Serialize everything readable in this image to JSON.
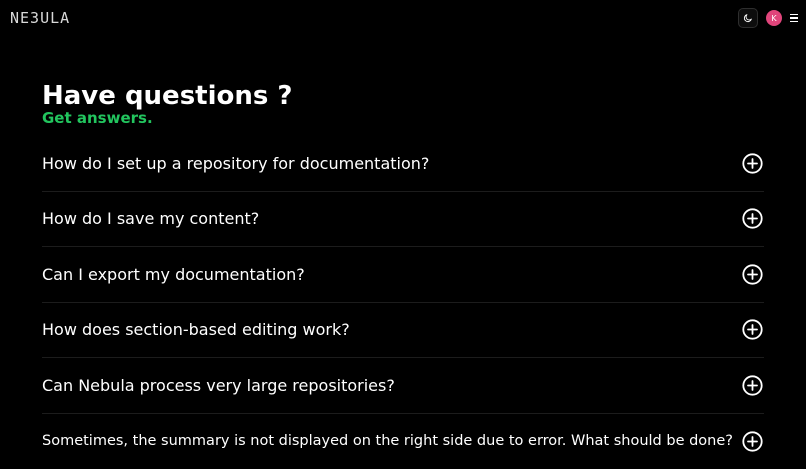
{
  "header": {
    "logo_text": "NE3ULA",
    "theme_icon": "moon-icon",
    "avatar_initial": "K",
    "avatar_color": "#e0457b",
    "menu_icon": "hamburger-menu-icon"
  },
  "faq": {
    "title": "Have questions ?",
    "subtitle": "Get answers.",
    "accent_color": "#22c55e",
    "toggle_icon": "plus-circle-icon",
    "items": [
      {
        "question": "How do I set up a repository for documentation?"
      },
      {
        "question": "How do I save my content?"
      },
      {
        "question": "Can I export my documentation?"
      },
      {
        "question": "How does section-based editing work?"
      },
      {
        "question": "Can Nebula process very large repositories?"
      },
      {
        "question": "Sometimes, the summary is not displayed on the right side due to error. What should be done?"
      }
    ]
  }
}
